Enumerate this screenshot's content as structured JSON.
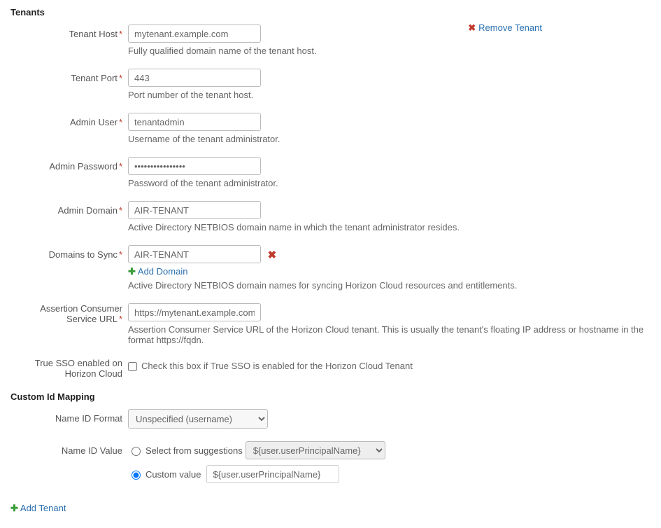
{
  "tenants": {
    "title": "Tenants",
    "remove_label": "Remove Tenant",
    "fields": {
      "host": {
        "label": "Tenant Host",
        "value": "mytenant.example.com",
        "help": "Fully qualified domain name of the tenant host."
      },
      "port": {
        "label": "Tenant Port",
        "value": "443",
        "help": "Port number of the tenant host."
      },
      "admin_user": {
        "label": "Admin User",
        "value": "tenantadmin",
        "help": "Username of the tenant administrator."
      },
      "admin_password": {
        "label": "Admin Password",
        "value": "••••••••••••••••",
        "help": "Password of the tenant administrator."
      },
      "admin_domain": {
        "label": "Admin Domain",
        "value": "AIR-TENANT",
        "help": "Active Directory NETBIOS domain name in which the tenant administrator resides."
      },
      "domains_sync": {
        "label": "Domains to Sync",
        "value": "AIR-TENANT",
        "add_label": "Add Domain",
        "help": "Active Directory NETBIOS domain names for syncing Horizon Cloud resources and entitlements."
      },
      "acs_url": {
        "label_line1": "Assertion Consumer",
        "label_line2": "Service URL",
        "value": "https://mytenant.example.com",
        "help": "Assertion Consumer Service URL of the Horizon Cloud tenant. This is usually the tenant's floating IP address or hostname in the format https://fqdn."
      },
      "true_sso": {
        "label_line1": "True SSO enabled on",
        "label_line2": "Horizon Cloud",
        "help": "Check this box if True SSO is enabled for the Horizon Cloud Tenant"
      }
    }
  },
  "custom_id": {
    "title": "Custom Id Mapping",
    "name_id_format": {
      "label": "Name ID Format",
      "selected": "Unspecified (username)"
    },
    "name_id_value": {
      "label": "Name ID Value",
      "suggestions_label": "Select from suggestions",
      "suggestions_selected": "${user.userPrincipalName}",
      "custom_label": "Custom value",
      "custom_value": "${user.userPrincipalName}"
    }
  },
  "footer": {
    "add_tenant": "Add Tenant"
  },
  "req": "*"
}
